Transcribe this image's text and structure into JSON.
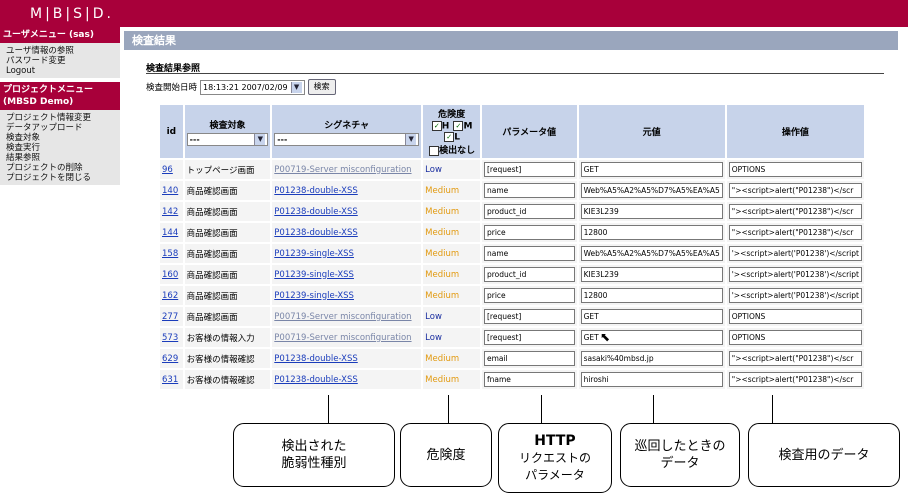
{
  "app": {
    "logo": "M|B|S|D."
  },
  "sidebar": {
    "user_menu_title": "ユーザメニュー (sas)",
    "user_items": [
      "ユーザ情報の参照",
      "パスワード変更",
      "Logout"
    ],
    "project_menu_title": "プロジェクトメニュー",
    "project_menu_subtitle": "(MBSD Demo)",
    "project_items": [
      "プロジェクト情報変更",
      "データアップロード",
      "検査対象",
      "検査実行",
      "結果参照",
      "プロジェクトの削除",
      "プロジェクトを閉じる"
    ]
  },
  "main": {
    "title": "検査結果",
    "section_title": "検査結果参照",
    "date_label": "検査開始日時",
    "date_value": "18:13:21 2007/02/09",
    "search_button": "検索"
  },
  "table": {
    "headers": {
      "id": "id",
      "target": "検査対象",
      "signature": "シグネチャ",
      "risk": "危険度",
      "param": "パラメータ値",
      "original": "元値",
      "operation": "操作値"
    },
    "target_filter": "---",
    "signature_filter": "---",
    "risk_filter": {
      "h": "H",
      "m": "M",
      "l": "L",
      "none": "検出なし"
    },
    "rows": [
      {
        "id": "96",
        "target": "トップページ画面",
        "signature": "P00719-Server misconfiguration",
        "sig_style": "grey",
        "risk": "Low",
        "param": "[request]",
        "original": "GET",
        "operation": "OPTIONS"
      },
      {
        "id": "140",
        "target": "商品確認画面",
        "signature": "P01238-double-XSS",
        "sig_style": "blue",
        "risk": "Medium",
        "param": "name",
        "original": "Web%A5%A2%A5%D7%A5%EA%A5",
        "operation": "\"><script>alert(\"P01238\")</scr"
      },
      {
        "id": "142",
        "target": "商品確認画面",
        "signature": "P01238-double-XSS",
        "sig_style": "blue",
        "risk": "Medium",
        "param": "product_id",
        "original": "KIE3L239",
        "operation": "\"><script>alert(\"P01238\")</scr"
      },
      {
        "id": "144",
        "target": "商品確認画面",
        "signature": "P01238-double-XSS",
        "sig_style": "blue",
        "risk": "Medium",
        "param": "price",
        "original": "12800",
        "operation": "\"><script>alert(\"P01238\")</scr"
      },
      {
        "id": "158",
        "target": "商品確認画面",
        "signature": "P01239-single-XSS",
        "sig_style": "blue",
        "risk": "Medium",
        "param": "name",
        "original": "Web%A5%A2%A5%D7%A5%EA%A5",
        "operation": "'><script>alert('P01238')</script"
      },
      {
        "id": "160",
        "target": "商品確認画面",
        "signature": "P01239-single-XSS",
        "sig_style": "blue",
        "risk": "Medium",
        "param": "product_id",
        "original": "KIE3L239",
        "operation": "'><script>alert('P01238')</script"
      },
      {
        "id": "162",
        "target": "商品確認画面",
        "signature": "P01239-single-XSS",
        "sig_style": "blue",
        "risk": "Medium",
        "param": "price",
        "original": "12800",
        "operation": "'><script>alert('P01238')</script"
      },
      {
        "id": "277",
        "target": "商品確認画面",
        "signature": "P00719-Server misconfiguration",
        "sig_style": "grey",
        "risk": "Low",
        "param": "[request]",
        "original": "GET",
        "operation": "OPTIONS"
      },
      {
        "id": "573",
        "target": "お客様の情報入力",
        "signature": "P00719-Server misconfiguration",
        "sig_style": "grey",
        "risk": "Low",
        "param": "[request]",
        "original": "GET",
        "operation": "OPTIONS"
      },
      {
        "id": "629",
        "target": "お客様の情報確認",
        "signature": "P01238-double-XSS",
        "sig_style": "blue",
        "risk": "Medium",
        "param": "email",
        "original": "sasaki%40mbsd.jp",
        "operation": "\"><script>alert(\"P01238\")</scr"
      },
      {
        "id": "631",
        "target": "お客様の情報確認",
        "signature": "P01238-double-XSS",
        "sig_style": "blue",
        "risk": "Medium",
        "param": "fname",
        "original": "hiroshi",
        "operation": "\"><script>alert(\"P01238\")</scr"
      }
    ]
  },
  "callouts": {
    "vuln_type_line1": "検出された",
    "vuln_type_line2": "脆弱性種別",
    "risk": "危険度",
    "http_title": "HTTP",
    "http_line1": "リクエストの",
    "http_line2": "パラメータ",
    "original_line1": "巡回したときの",
    "original_line2": "データ",
    "operation": "検査用のデータ"
  },
  "colors": {
    "brand": "#a8003a",
    "title_bar": "#9aa6bd",
    "header_cell": "#c7d3ea",
    "link": "#1a3cbb",
    "risk_low": "#1a2ea0",
    "risk_medium": "#e29a10"
  }
}
